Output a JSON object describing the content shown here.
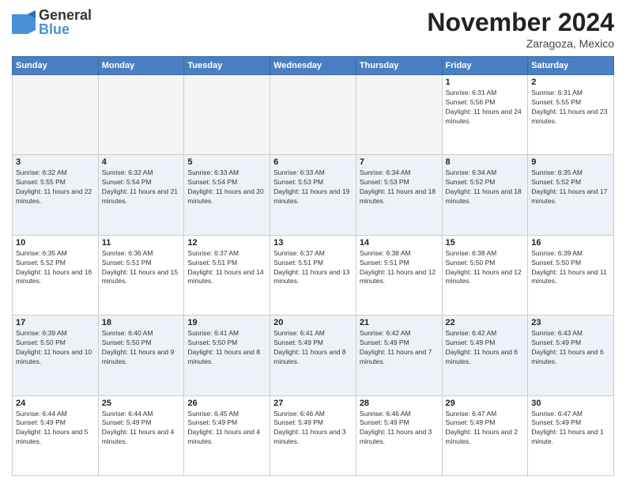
{
  "logo": {
    "general": "General",
    "blue": "Blue"
  },
  "header": {
    "month": "November 2024",
    "location": "Zaragoza, Mexico"
  },
  "days_of_week": [
    "Sunday",
    "Monday",
    "Tuesday",
    "Wednesday",
    "Thursday",
    "Friday",
    "Saturday"
  ],
  "weeks": [
    [
      {
        "day": "",
        "info": ""
      },
      {
        "day": "",
        "info": ""
      },
      {
        "day": "",
        "info": ""
      },
      {
        "day": "",
        "info": ""
      },
      {
        "day": "",
        "info": ""
      },
      {
        "day": "1",
        "info": "Sunrise: 6:31 AM\nSunset: 5:56 PM\nDaylight: 11 hours and 24 minutes."
      },
      {
        "day": "2",
        "info": "Sunrise: 6:31 AM\nSunset: 5:55 PM\nDaylight: 11 hours and 23 minutes."
      }
    ],
    [
      {
        "day": "3",
        "info": "Sunrise: 6:32 AM\nSunset: 5:55 PM\nDaylight: 11 hours and 22 minutes."
      },
      {
        "day": "4",
        "info": "Sunrise: 6:32 AM\nSunset: 5:54 PM\nDaylight: 11 hours and 21 minutes."
      },
      {
        "day": "5",
        "info": "Sunrise: 6:33 AM\nSunset: 5:54 PM\nDaylight: 11 hours and 20 minutes."
      },
      {
        "day": "6",
        "info": "Sunrise: 6:33 AM\nSunset: 5:53 PM\nDaylight: 11 hours and 19 minutes."
      },
      {
        "day": "7",
        "info": "Sunrise: 6:34 AM\nSunset: 5:53 PM\nDaylight: 11 hours and 18 minutes."
      },
      {
        "day": "8",
        "info": "Sunrise: 6:34 AM\nSunset: 5:52 PM\nDaylight: 11 hours and 18 minutes."
      },
      {
        "day": "9",
        "info": "Sunrise: 6:35 AM\nSunset: 5:52 PM\nDaylight: 11 hours and 17 minutes."
      }
    ],
    [
      {
        "day": "10",
        "info": "Sunrise: 6:35 AM\nSunset: 5:52 PM\nDaylight: 11 hours and 16 minutes."
      },
      {
        "day": "11",
        "info": "Sunrise: 6:36 AM\nSunset: 5:51 PM\nDaylight: 11 hours and 15 minutes."
      },
      {
        "day": "12",
        "info": "Sunrise: 6:37 AM\nSunset: 5:51 PM\nDaylight: 11 hours and 14 minutes."
      },
      {
        "day": "13",
        "info": "Sunrise: 6:37 AM\nSunset: 5:51 PM\nDaylight: 11 hours and 13 minutes."
      },
      {
        "day": "14",
        "info": "Sunrise: 6:38 AM\nSunset: 5:51 PM\nDaylight: 11 hours and 12 minutes."
      },
      {
        "day": "15",
        "info": "Sunrise: 6:38 AM\nSunset: 5:50 PM\nDaylight: 11 hours and 12 minutes."
      },
      {
        "day": "16",
        "info": "Sunrise: 6:39 AM\nSunset: 5:50 PM\nDaylight: 11 hours and 11 minutes."
      }
    ],
    [
      {
        "day": "17",
        "info": "Sunrise: 6:39 AM\nSunset: 5:50 PM\nDaylight: 11 hours and 10 minutes."
      },
      {
        "day": "18",
        "info": "Sunrise: 6:40 AM\nSunset: 5:50 PM\nDaylight: 11 hours and 9 minutes."
      },
      {
        "day": "19",
        "info": "Sunrise: 6:41 AM\nSunset: 5:50 PM\nDaylight: 11 hours and 8 minutes."
      },
      {
        "day": "20",
        "info": "Sunrise: 6:41 AM\nSunset: 5:49 PM\nDaylight: 11 hours and 8 minutes."
      },
      {
        "day": "21",
        "info": "Sunrise: 6:42 AM\nSunset: 5:49 PM\nDaylight: 11 hours and 7 minutes."
      },
      {
        "day": "22",
        "info": "Sunrise: 6:42 AM\nSunset: 5:49 PM\nDaylight: 11 hours and 6 minutes."
      },
      {
        "day": "23",
        "info": "Sunrise: 6:43 AM\nSunset: 5:49 PM\nDaylight: 11 hours and 6 minutes."
      }
    ],
    [
      {
        "day": "24",
        "info": "Sunrise: 6:44 AM\nSunset: 5:49 PM\nDaylight: 11 hours and 5 minutes."
      },
      {
        "day": "25",
        "info": "Sunrise: 6:44 AM\nSunset: 5:49 PM\nDaylight: 11 hours and 4 minutes."
      },
      {
        "day": "26",
        "info": "Sunrise: 6:45 AM\nSunset: 5:49 PM\nDaylight: 11 hours and 4 minutes."
      },
      {
        "day": "27",
        "info": "Sunrise: 6:46 AM\nSunset: 5:49 PM\nDaylight: 11 hours and 3 minutes."
      },
      {
        "day": "28",
        "info": "Sunrise: 6:46 AM\nSunset: 5:49 PM\nDaylight: 11 hours and 3 minutes."
      },
      {
        "day": "29",
        "info": "Sunrise: 6:47 AM\nSunset: 5:49 PM\nDaylight: 11 hours and 2 minutes."
      },
      {
        "day": "30",
        "info": "Sunrise: 6:47 AM\nSunset: 5:49 PM\nDaylight: 11 hours and 1 minute."
      }
    ]
  ]
}
